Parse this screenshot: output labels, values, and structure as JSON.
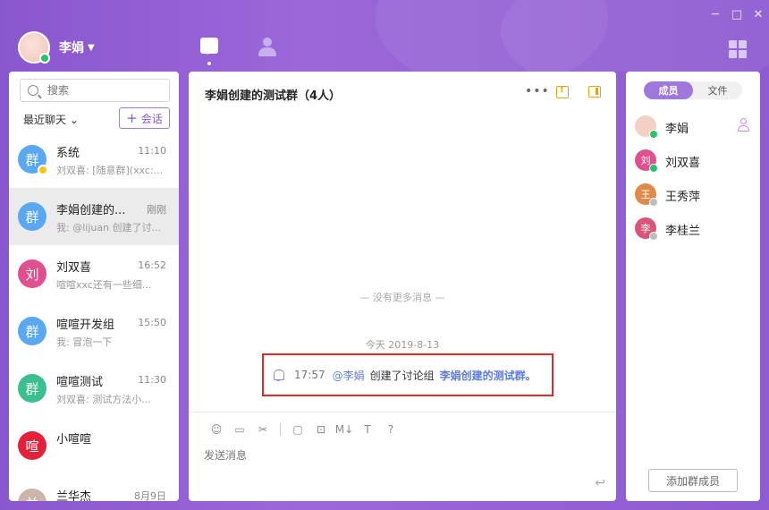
{
  "window": {
    "minimize": "─",
    "maximize": "□",
    "close": "✕"
  },
  "user": {
    "name": "李娟",
    "status": "online"
  },
  "search": {
    "placeholder": "搜索"
  },
  "left_panel": {
    "sort_label": "最近聊天",
    "new_chat_label": "会话"
  },
  "conversations": [
    {
      "avatar_text": "群",
      "avatar_color": "#5aa7f2",
      "name": "系统",
      "time": "11:10",
      "preview": "刘双喜: [随意群](xxc:..."
    },
    {
      "avatar_text": "群",
      "avatar_color": "#5aa7f2",
      "name": "李娟创建的...",
      "time": "刚刚",
      "preview": "我: @lijuan 创建了讨..."
    },
    {
      "avatar_text": "刘",
      "avatar_color": "#e0508f",
      "name": "刘双喜",
      "time": "16:52",
      "preview": "喧喧xxc还有一些细..."
    },
    {
      "avatar_text": "群",
      "avatar_color": "#5aa7f2",
      "name": "喧喧开发组",
      "time": "15:50",
      "preview": "我: 冒泡一下"
    },
    {
      "avatar_text": "群",
      "avatar_color": "#3bbf8f",
      "name": "喧喧测试",
      "time": "11:30",
      "preview": "刘双喜: 测试方法小..."
    },
    {
      "avatar_text": "喧",
      "avatar_color": "#e3213a",
      "name": "小喧喧",
      "time": "",
      "preview": ""
    },
    {
      "avatar_text": "兰",
      "avatar_color": "#c9b6a8",
      "name": "兰华杰",
      "time": "8月9日",
      "preview": ""
    }
  ],
  "chat": {
    "title": "李娟创建的测试群（4人）",
    "more": "•••",
    "no_more": "— 没有更多消息 —",
    "date": "今天 2019-8-13",
    "notice": {
      "time": "17:57",
      "mention": "@李娟",
      "text": "创建了讨论组",
      "group": "李娟创建的测试群。"
    },
    "input_placeholder": "发送消息",
    "toolbar": [
      "☺",
      "▭",
      "✂",
      "▢",
      "⊡",
      "M↓",
      "T",
      "?"
    ],
    "send_icon": "↩"
  },
  "right_panel": {
    "tabs": [
      "成员",
      "文件"
    ],
    "members": [
      {
        "avatar_text": "",
        "avatar_color": "#f3cfc4",
        "name": "李娟",
        "status_color": "#27c36a",
        "owner": true
      },
      {
        "avatar_text": "刘",
        "avatar_color": "#e0508f",
        "name": "刘双喜",
        "status_color": "#27c36a",
        "owner": false
      },
      {
        "avatar_text": "王",
        "avatar_color": "#e08a4a",
        "name": "王秀萍",
        "status_color": "#bdbdbd",
        "owner": false
      },
      {
        "avatar_text": "李",
        "avatar_color": "#d9557a",
        "name": "李桂兰",
        "status_color": "#bdbdbd",
        "owner": false
      }
    ],
    "add_member_label": "添加群成员"
  }
}
